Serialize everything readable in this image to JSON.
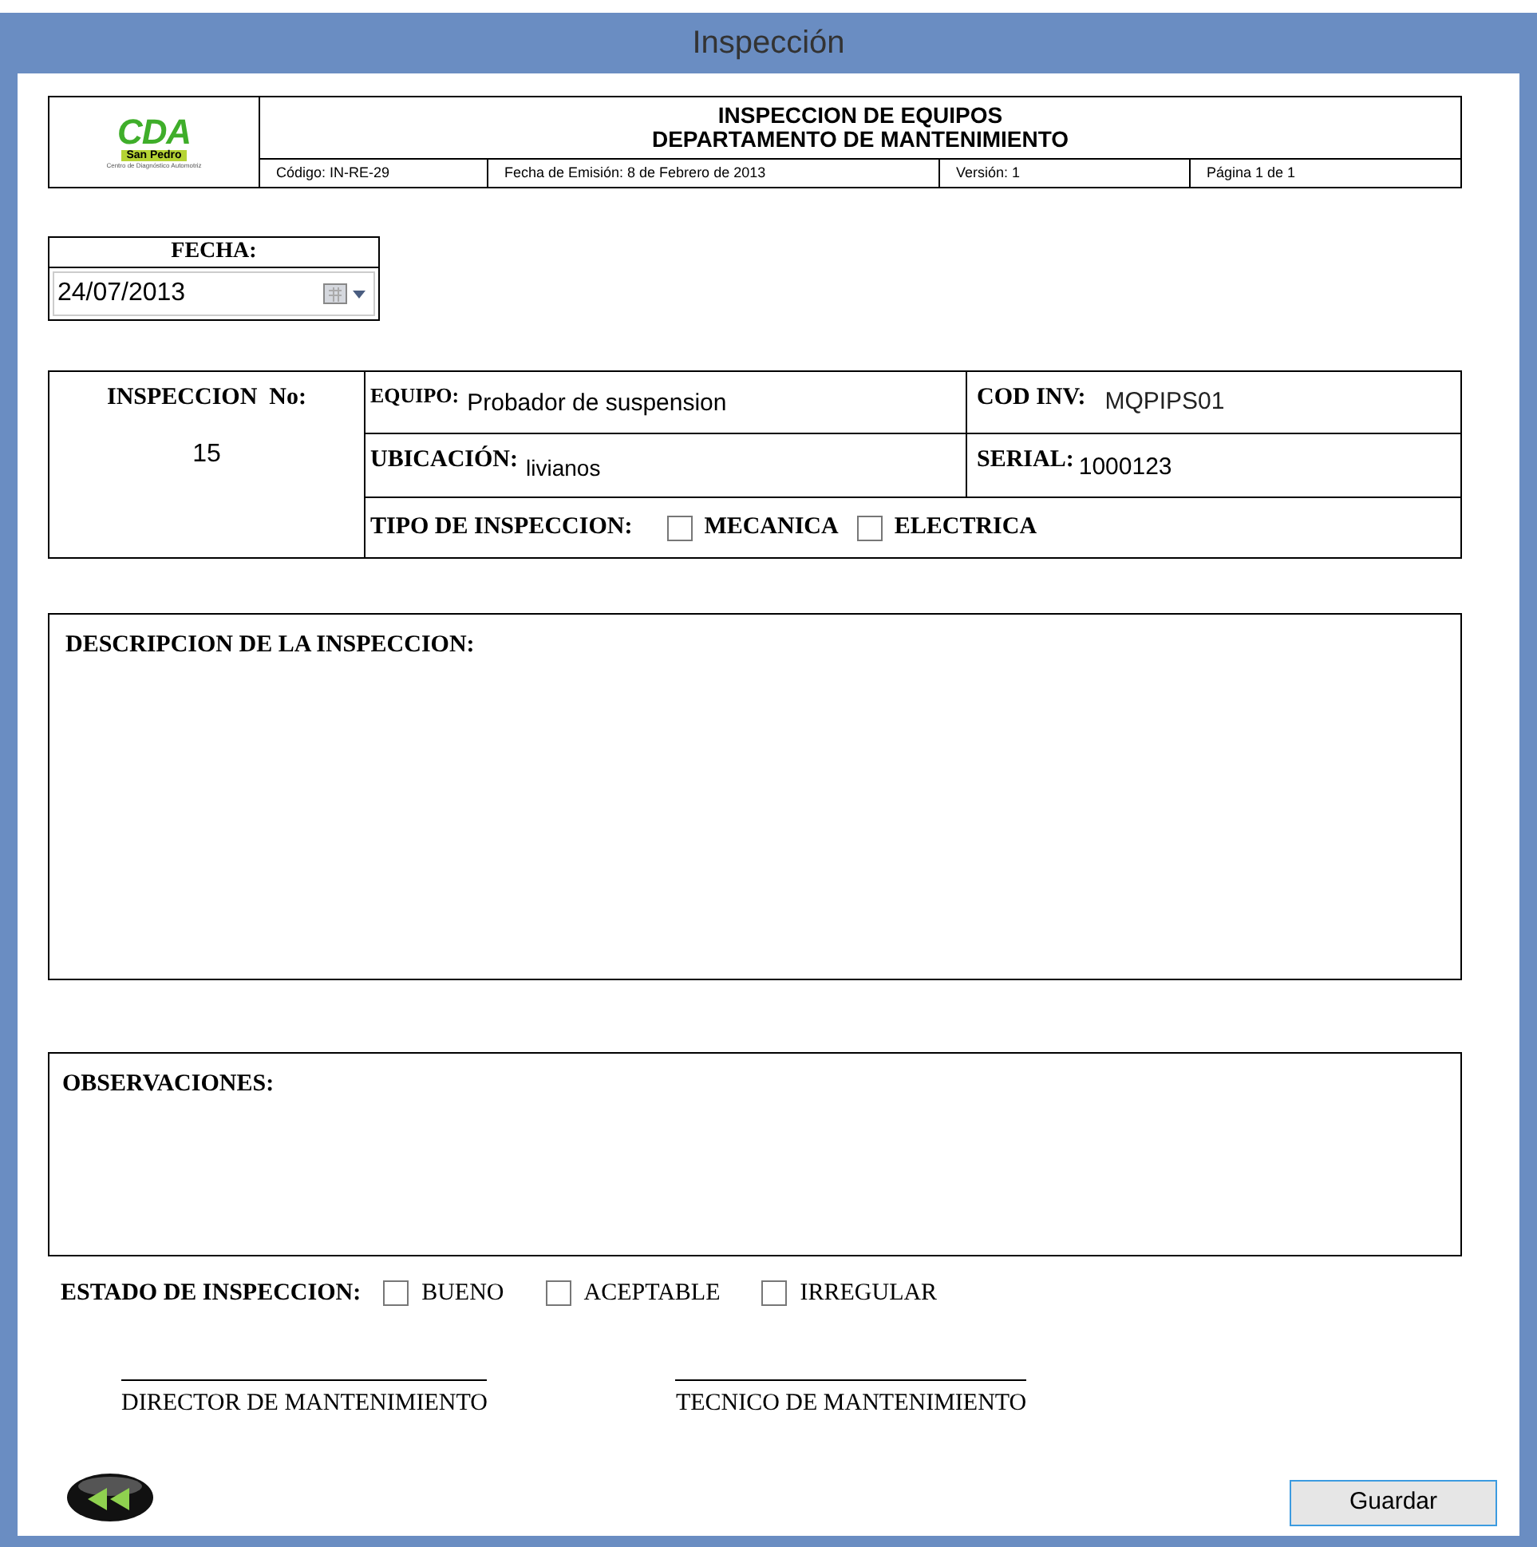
{
  "window": {
    "title": "Inspección"
  },
  "header": {
    "logo_text": "CDA",
    "logo_subtitle": "San Pedro",
    "logo_caption": "Centro de Diagnóstico Automotriz",
    "title": "INSPECCION DE EQUIPOS",
    "subtitle": "DEPARTAMENTO DE MANTENIMIENTO",
    "cells": [
      "Código: IN-RE-29",
      "Fecha de Emisión: 8 de Febrero de 2013",
      "Versión: 1",
      "Página 1 de 1"
    ]
  },
  "fecha": {
    "label": "FECHA:",
    "value": "24/07/2013"
  },
  "info": {
    "number_label": "INSPECCION  No:",
    "number": "15",
    "equipo_label": "EQUIPO:",
    "equipo": "Probador de suspension",
    "cod_label": "COD INV:",
    "cod": "MQPIPS01",
    "ubicacion_label": "UBICACIÓN:",
    "ubicacion": "livianos",
    "serial_label": "SERIAL:",
    "serial": "1000123",
    "tipo_label": "TIPO DE INSPECCION:",
    "tipo_options": [
      {
        "label": "MECANICA",
        "checked": false
      },
      {
        "label": "ELECTRICA",
        "checked": false
      }
    ]
  },
  "descripcion": {
    "label": "DESCRIPCION DE LA INSPECCION:"
  },
  "observaciones": {
    "label": "OBSERVACIONES:"
  },
  "estado": {
    "label": "ESTADO DE INSPECCION:",
    "options": [
      {
        "label": "BUENO",
        "checked": false
      },
      {
        "label": "ACEPTABLE",
        "checked": false
      },
      {
        "label": "IRREGULAR",
        "checked": false
      }
    ]
  },
  "signatures": [
    "DIRECTOR DE MANTENIMIENTO",
    "TECNICO DE MANTENIMIENTO"
  ],
  "buttons": {
    "save": "Guardar"
  }
}
